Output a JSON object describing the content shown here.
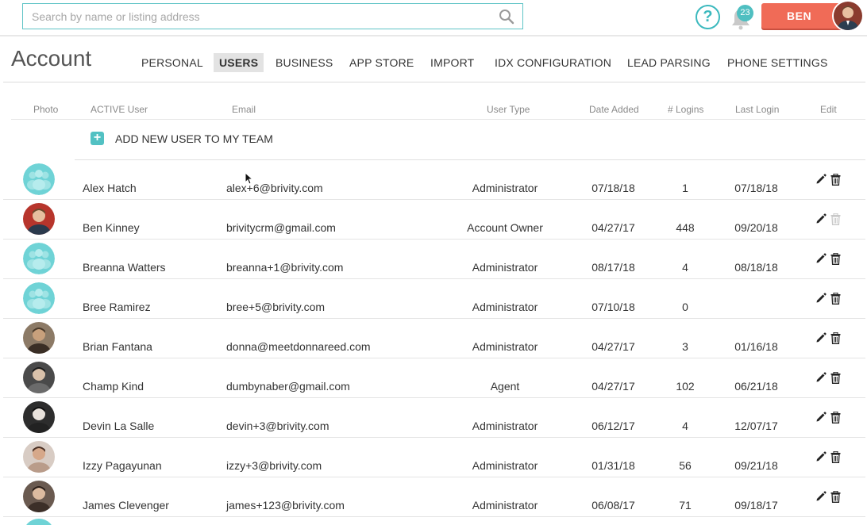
{
  "search": {
    "placeholder": "Search by name or listing address",
    "value": ""
  },
  "header": {
    "help_icon": "question-circle-icon",
    "notifications": {
      "icon": "bell-icon",
      "count": "23"
    },
    "user_button": "BEN"
  },
  "page": {
    "title": "Account"
  },
  "tabs": [
    {
      "label": "PERSONAL",
      "active": false
    },
    {
      "label": "USERS",
      "active": true
    },
    {
      "label": "BUSINESS",
      "active": false
    },
    {
      "label": "APP STORE",
      "active": false
    },
    {
      "label": "IMPORT",
      "active": false
    },
    {
      "label": "IDX CONFIGURATION",
      "active": false
    },
    {
      "label": "LEAD PARSING",
      "active": false
    },
    {
      "label": "PHONE SETTINGS",
      "active": false
    }
  ],
  "table": {
    "columns": [
      "Photo",
      "ACTIVE User",
      "Email",
      "User Type",
      "Date Added",
      "# Logins",
      "Last Login",
      "Edit"
    ],
    "add_user_label": "ADD NEW USER TO MY TEAM",
    "rows": [
      {
        "name": "Alex Hatch",
        "email": "alex+6@brivity.com",
        "type": "Administrator",
        "date_added": "07/18/18",
        "logins": "1",
        "last_login": "07/18/18",
        "photo": "default",
        "trash_enabled": true
      },
      {
        "name": "Ben Kinney",
        "email": "brivitycrm@gmail.com",
        "type": "Account Owner",
        "date_added": "04/27/17",
        "logins": "448",
        "last_login": "09/20/18",
        "photo": "photo",
        "trash_enabled": false
      },
      {
        "name": "Breanna Watters",
        "email": "breanna+1@brivity.com",
        "type": "Administrator",
        "date_added": "08/17/18",
        "logins": "4",
        "last_login": "08/18/18",
        "photo": "default",
        "trash_enabled": true
      },
      {
        "name": "Bree Ramirez",
        "email": "bree+5@brivity.com",
        "type": "Administrator",
        "date_added": "07/10/18",
        "logins": "0",
        "last_login": "",
        "photo": "default",
        "trash_enabled": true
      },
      {
        "name": "Brian Fantana",
        "email": "donna@meetdonnareed.com",
        "type": "Administrator",
        "date_added": "04/27/17",
        "logins": "3",
        "last_login": "01/16/18",
        "photo": "photo",
        "trash_enabled": true
      },
      {
        "name": "Champ Kind",
        "email": "dumbynaber@gmail.com",
        "type": "Agent",
        "date_added": "04/27/17",
        "logins": "102",
        "last_login": "06/21/18",
        "photo": "photo",
        "trash_enabled": true
      },
      {
        "name": "Devin La Salle",
        "email": "devin+3@brivity.com",
        "type": "Administrator",
        "date_added": "06/12/17",
        "logins": "4",
        "last_login": "12/07/17",
        "photo": "photo",
        "trash_enabled": true
      },
      {
        "name": "Izzy Pagayunan",
        "email": "izzy+3@brivity.com",
        "type": "Administrator",
        "date_added": "01/31/18",
        "logins": "56",
        "last_login": "09/21/18",
        "photo": "photo",
        "trash_enabled": true
      },
      {
        "name": "James Clevenger",
        "email": "james+123@brivity.com",
        "type": "Administrator",
        "date_added": "06/08/17",
        "logins": "71",
        "last_login": "09/18/17",
        "photo": "photo",
        "trash_enabled": true
      }
    ]
  },
  "colors": {
    "accent": "#3cb9be",
    "user_button": "#f06b57",
    "default_avatar": "#6fd3d6"
  }
}
